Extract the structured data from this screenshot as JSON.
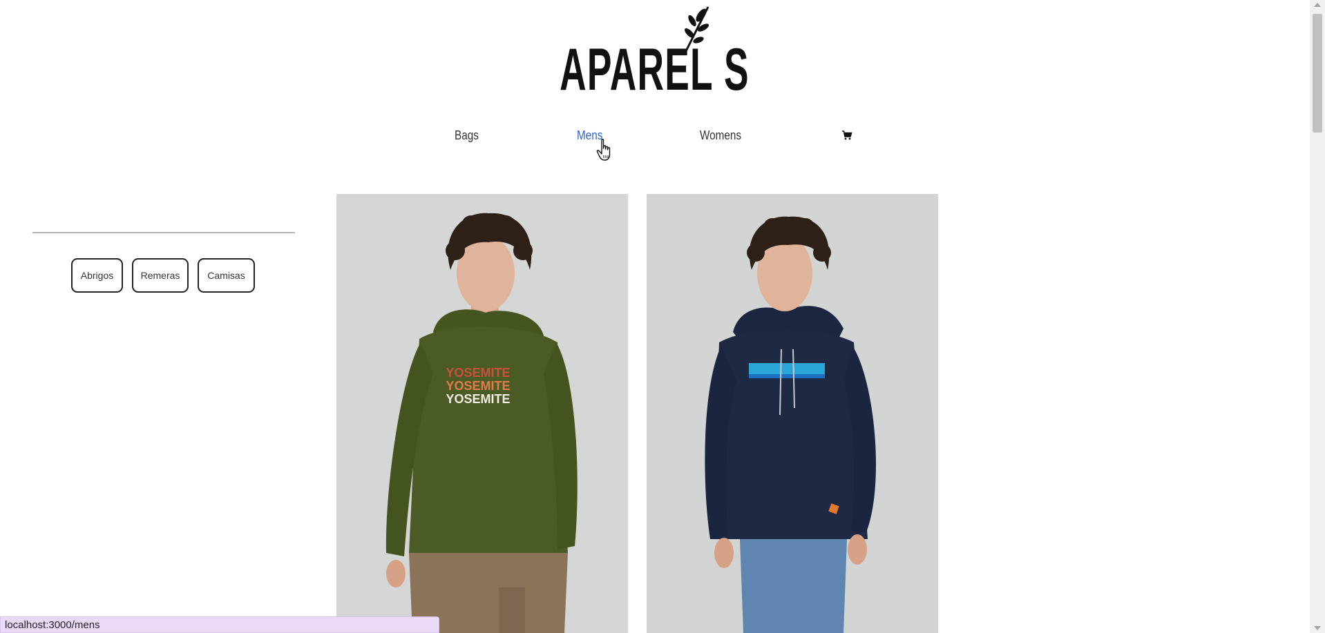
{
  "brand": {
    "logo_text": "APAREL S"
  },
  "nav": {
    "items": [
      {
        "label": "Bags"
      },
      {
        "label": "Mens"
      },
      {
        "label": "Womens"
      }
    ],
    "cart_icon": "shopping-cart-icon"
  },
  "sidebar": {
    "filters": [
      {
        "label": "Abrigos"
      },
      {
        "label": "Remeras"
      },
      {
        "label": "Camisas"
      }
    ]
  },
  "products": [
    {
      "image": "olive-green-hoodie-photo",
      "print_text": "YOSEMITE"
    },
    {
      "image": "navy-hoodie-photo"
    }
  ],
  "status_bar": {
    "url": "localhost:3000/mens"
  },
  "colors": {
    "accent_link": "#2f63c8",
    "status_bar_bg": "#ead9f7",
    "hoodie_green": "#4a5b26",
    "hoodie_navy": "#1e2a44"
  }
}
